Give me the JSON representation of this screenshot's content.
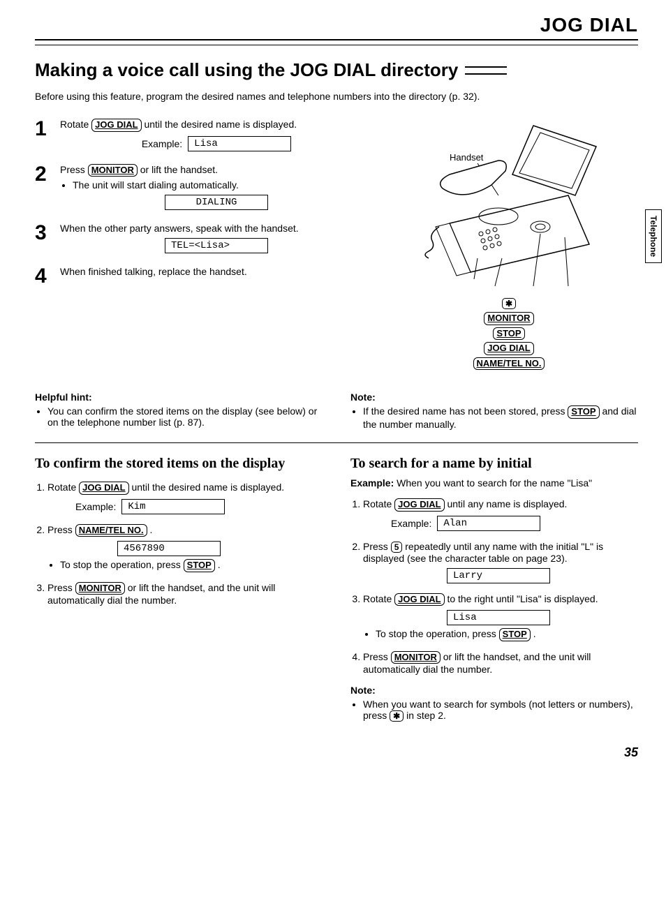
{
  "header": {
    "section": "JOG DIAL",
    "tab": "Telephone"
  },
  "title": "Making a voice call using the JOG DIAL directory",
  "intro": "Before using this feature, program the desired names and telephone numbers into the directory (p. 32).",
  "steps": {
    "s1": {
      "num": "1",
      "text_a": "Rotate ",
      "key": "JOG DIAL",
      "text_b": " until the desired name is displayed.",
      "example_label": "Example:",
      "lcd": "Lisa"
    },
    "s2": {
      "num": "2",
      "text_a": "Press ",
      "key": "MONITOR",
      "text_b": " or lift the handset.",
      "bullet": "The unit will start dialing automatically.",
      "lcd": "DIALING"
    },
    "s3": {
      "num": "3",
      "text": "When the other party answers, speak with the handset.",
      "lcd": "TEL=<Lisa>"
    },
    "s4": {
      "num": "4",
      "text": "When finished talking, replace the handset."
    }
  },
  "diagram": {
    "handset": "Handset",
    "star": "✱",
    "monitor": "MONITOR",
    "stop": "STOP",
    "jogdial": "JOG DIAL",
    "nametel": "NAME/TEL NO."
  },
  "hint": {
    "heading": "Helpful hint:",
    "bullet": "You can confirm the stored items on the display (see below) or on the telephone number list (p. 87)."
  },
  "note": {
    "heading": "Note:",
    "bullet_a": "If the desired name has not been stored, press ",
    "key": "STOP",
    "bullet_b": " and dial the number manually."
  },
  "confirm": {
    "title": "To confirm the stored items on the display",
    "i1_a": "Rotate ",
    "i1_key": "JOG DIAL",
    "i1_b": " until the desired name is displayed.",
    "i1_example_label": "Example:",
    "i1_lcd": "Kim",
    "i2_a": "Press ",
    "i2_key": "NAME/TEL NO.",
    "i2_b": " .",
    "i2_lcd": "4567890",
    "i2_bullet_a": "To stop the operation, press ",
    "i2_bullet_key": "STOP",
    "i2_bullet_b": " .",
    "i3_a": "Press ",
    "i3_key": "MONITOR",
    "i3_b": " or lift the handset, and the unit will automatically dial the number."
  },
  "search": {
    "title": "To search for a name by initial",
    "example_a": "Example:",
    "example_b": " When you want to search for the name \"Lisa\"",
    "i1_a": "Rotate ",
    "i1_key": "JOG DIAL",
    "i1_b": " until any name is displayed.",
    "i1_example_label": "Example:",
    "i1_lcd": "Alan",
    "i2_a": "Press ",
    "i2_key": "5",
    "i2_b": " repeatedly until any name with the initial \"L\" is displayed (see the character table on page 23).",
    "i2_lcd": "Larry",
    "i3_a": "Rotate ",
    "i3_key": "JOG DIAL",
    "i3_b": " to the right until \"Lisa\" is displayed.",
    "i3_lcd": "Lisa",
    "i3_bullet_a": "To stop the operation, press ",
    "i3_bullet_key": "STOP",
    "i3_bullet_b": " .",
    "i4_a": "Press ",
    "i4_key": "MONITOR",
    "i4_b": " or lift the handset, and the unit will automatically dial the number.",
    "note_heading": "Note:",
    "note_a": "When you want to search for symbols (not letters or numbers), press ",
    "note_key": "✱",
    "note_b": " in step 2."
  },
  "page_number": "35"
}
